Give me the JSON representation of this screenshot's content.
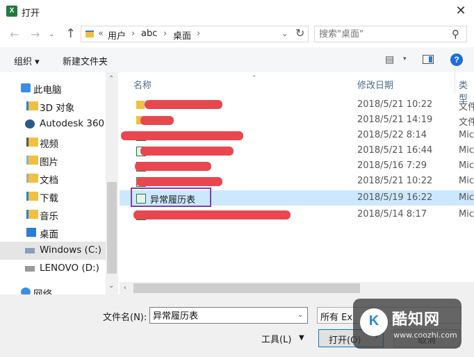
{
  "window": {
    "title": "打开",
    "app_icon": "X",
    "close_glyph": "✕"
  },
  "address": {
    "back_glyph": "←",
    "forward_glyph": "→",
    "recent_glyph": "⌄",
    "up_glyph": "↑",
    "overflow": "«",
    "crumbs": [
      "用户",
      "abc",
      "桌面"
    ],
    "separator": "›",
    "dropdown_glyph": "⌄",
    "refresh_glyph": "↻"
  },
  "search": {
    "placeholder": "搜索\"桌面\"",
    "icon_glyph": "⚲"
  },
  "toolbar": {
    "organize_label": "组织 ▾",
    "new_folder_label": "新建文件夹",
    "view_glyph": "▤",
    "view_drop_glyph": "▾",
    "help_glyph": "?"
  },
  "nav": {
    "items": [
      {
        "label": "此电脑",
        "icon": "computer-icon",
        "color": "#3a8ee6"
      },
      {
        "label": "3D 对象",
        "icon": "3d-objects-icon",
        "color": "#f0c040"
      },
      {
        "label": "Autodesk 360",
        "icon": "autodesk-icon",
        "color": "#2a5a8a"
      },
      {
        "label": "视频",
        "icon": "video-icon",
        "color": "#f0c040"
      },
      {
        "label": "图片",
        "icon": "pictures-icon",
        "color": "#f0c040"
      },
      {
        "label": "文档",
        "icon": "documents-icon",
        "color": "#f0c040"
      },
      {
        "label": "下载",
        "icon": "downloads-icon",
        "color": "#2a7fd4"
      },
      {
        "label": "音乐",
        "icon": "music-icon",
        "color": "#f0c040"
      },
      {
        "label": "桌面",
        "icon": "desktop-icon",
        "color": "#2a7fd4"
      },
      {
        "label": "Windows (C:)",
        "icon": "drive-c-icon",
        "color": "#8aa0b8"
      },
      {
        "label": "LENOVO (D:)",
        "icon": "drive-d-icon",
        "color": "#9a9a9a"
      },
      {
        "label": "网络",
        "icon": "network-icon",
        "color": "#3a8ee6"
      }
    ],
    "scroll_up_glyph": "⌃",
    "scroll_down_glyph": "⌄"
  },
  "list": {
    "columns": {
      "name": "名称",
      "date": "修改日期",
      "type": "类型"
    },
    "sort_glyph": "⌃",
    "rows": [
      {
        "name": "",
        "date": "2018/5/21 10:22",
        "type": "文件",
        "icon": "folder-icon",
        "redacted": true
      },
      {
        "name": "",
        "date": "2018/5/21 14:19",
        "type": "文件",
        "icon": "folder-icon",
        "redacted": true
      },
      {
        "name": "",
        "date": "2018/5/22 8:14",
        "type": "Mic",
        "icon": "excel-file-icon",
        "redacted": true
      },
      {
        "name": "",
        "date": "2018/5/21 16:44",
        "type": "Mic",
        "icon": "excel-file-icon",
        "redacted": true
      },
      {
        "name": "",
        "date": "2018/5/16 7:29",
        "type": "Mic",
        "icon": "excel-file-icon",
        "redacted": true
      },
      {
        "name": "",
        "date": "2018/5/21 10:22",
        "type": "Mic",
        "icon": "excel-file-icon",
        "redacted": true
      },
      {
        "name": "异常履历表",
        "date": "2018/5/19 16:22",
        "type": "Mic",
        "icon": "excel-file-icon",
        "redacted": false
      },
      {
        "name": "",
        "date": "2018/5/14 8:17",
        "type": "Mic",
        "icon": "excel-file-icon",
        "redacted": true
      }
    ],
    "hscroll_left_glyph": "‹"
  },
  "bottom": {
    "filename_label": "文件名(N):",
    "filename_value": "异常履历表",
    "filename_drop_glyph": "⌄",
    "filetype_value": "所有 Ex",
    "tools_label": "工具(L)",
    "tools_drop_glyph": "▼",
    "open_label": "打开(O)",
    "open_split_glyph": "▾",
    "cancel_label": "取消"
  },
  "watermark": {
    "logo": "K",
    "title": "酷知网",
    "url": "www.coozhi.com"
  },
  "colors": {
    "accent": "#0078d7",
    "selection": "#cce8ff",
    "highlight_border": "#7b3fb0",
    "redaction": "#e8474f"
  }
}
